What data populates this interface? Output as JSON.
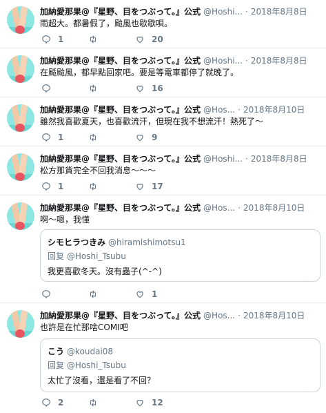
{
  "tweets": [
    {
      "name": "加納愛那果@『星野、目をつぶって。』公式",
      "handle": "@Hoshi...",
      "date": "2018年8月8日",
      "text": "雨超大。都暑假了，颱風也歇歇唄。",
      "replies": "1",
      "retweets": "",
      "likes": "20"
    },
    {
      "name": "加納愛那果@『星野、目をつぶって。』公式",
      "handle": "@Hoshi...",
      "date": "2018年8月8日",
      "text": "在颳颱風，都早點回家吧。要是等電車都停了就晚了。",
      "replies": "",
      "retweets": "",
      "likes": "16"
    },
    {
      "name": "加納愛那果@『星野、目をつぶって。』公式",
      "handle": "@Hos...",
      "date": "2018年8月10日",
      "text": "雖然我喜歡夏天，也喜歡流汗，但現在我不想流汗！熱死了～",
      "replies": "1",
      "retweets": "",
      "likes": "9"
    },
    {
      "name": "加納愛那果@『星野、目をつぶって。』公式",
      "handle": "@Hoshi...",
      "date": "2018年8月8日",
      "text": "松方那貨完全不回我消息～～～",
      "replies": "1",
      "retweets": "",
      "likes": "17"
    },
    {
      "name": "加納愛那果@『星野、目をつぶって。』公式",
      "handle": "@Hos...",
      "date": "2018年8月10日",
      "text": "啊～嗯，我懂",
      "quote": {
        "name": "シモヒラつきみ",
        "handle": "@hiramishimotsu1",
        "reply_prefix": "回复",
        "reply_to": "@Hoshi_Tsubu",
        "text": "我更喜歡冬天。沒有蟲子(^-^)"
      },
      "replies": "",
      "retweets": "",
      "likes": "1"
    },
    {
      "name": "加納愛那果@『星野、目をつぶって。』公式",
      "handle": "@Hos...",
      "date": "2018年8月10日",
      "text": "也許是在忙那啥COMI吧",
      "quote": {
        "name": "こう",
        "handle": "@koudai08",
        "reply_prefix": "回复",
        "reply_to": "@Hoshi_Tsubu",
        "text": "太忙了沒看，還是看了不回？"
      },
      "replies": "2",
      "retweets": "",
      "likes": "12"
    }
  ],
  "icons": {
    "reply": "reply-icon",
    "retweet": "retweet-icon",
    "like": "heart-icon"
  },
  "colors": {
    "text": "#14171a",
    "muted": "#657786",
    "divider": "#e6ecf0",
    "avatar_bg": "#8ee6e2"
  }
}
